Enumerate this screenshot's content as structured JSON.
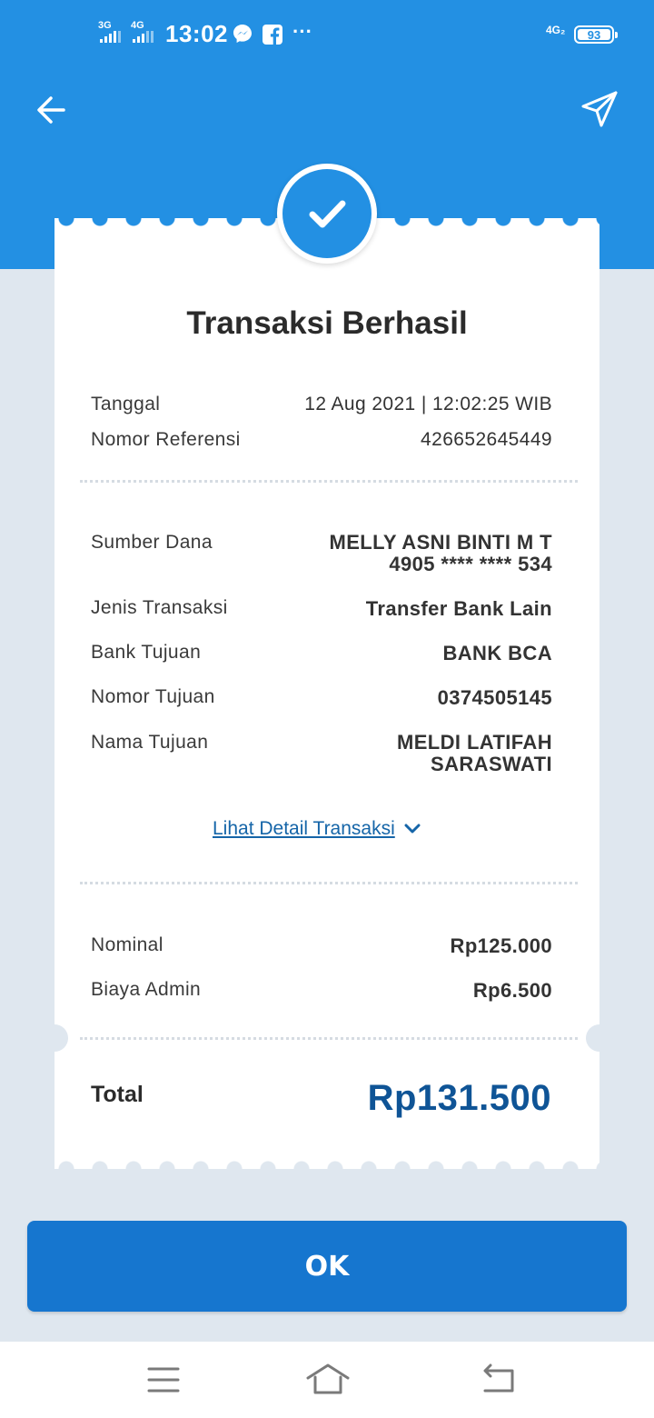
{
  "status_bar": {
    "signal1": "3G",
    "signal2": "4G",
    "time": "13:02",
    "more": "···",
    "network": "4G₂",
    "battery": "93"
  },
  "header": {
    "back_icon": "arrow-left-icon",
    "share_icon": "send-icon",
    "accent_color": "#2390e3"
  },
  "receipt": {
    "status_icon": "check-icon",
    "title": "Transaksi Berhasil",
    "tanggal_label": "Tanggal",
    "tanggal_value": "12 Aug 2021 | 12:02:25 WIB",
    "referensi_label": "Nomor Referensi",
    "referensi_value": "426652645449",
    "sumber_label": "Sumber Dana",
    "sumber_name": "MELLY ASNI BINTI M T",
    "sumber_account": "4905 **** **** 534",
    "jenis_label": "Jenis Transaksi",
    "jenis_value": "Transfer Bank Lain",
    "bank_label": "Bank Tujuan",
    "bank_value": "BANK BCA",
    "nomor_tujuan_label": "Nomor Tujuan",
    "nomor_tujuan_value": "0374505145",
    "nama_tujuan_label": "Nama Tujuan",
    "nama_tujuan_line1": "MELDI LATIFAH",
    "nama_tujuan_line2": "SARASWATI",
    "detail_link": "Lihat Detail Transaksi",
    "nominal_label": "Nominal",
    "nominal_value": "Rp125.000",
    "admin_label": "Biaya Admin",
    "admin_value": "Rp6.500",
    "total_label": "Total",
    "total_value": "Rp131.500",
    "total_color": "#0f5496"
  },
  "actions": {
    "ok_label": "OK",
    "button_color": "#1676cf"
  },
  "nav_bar": {
    "menu_icon": "menu-icon",
    "home_icon": "home-icon",
    "back_icon": "return-icon"
  }
}
